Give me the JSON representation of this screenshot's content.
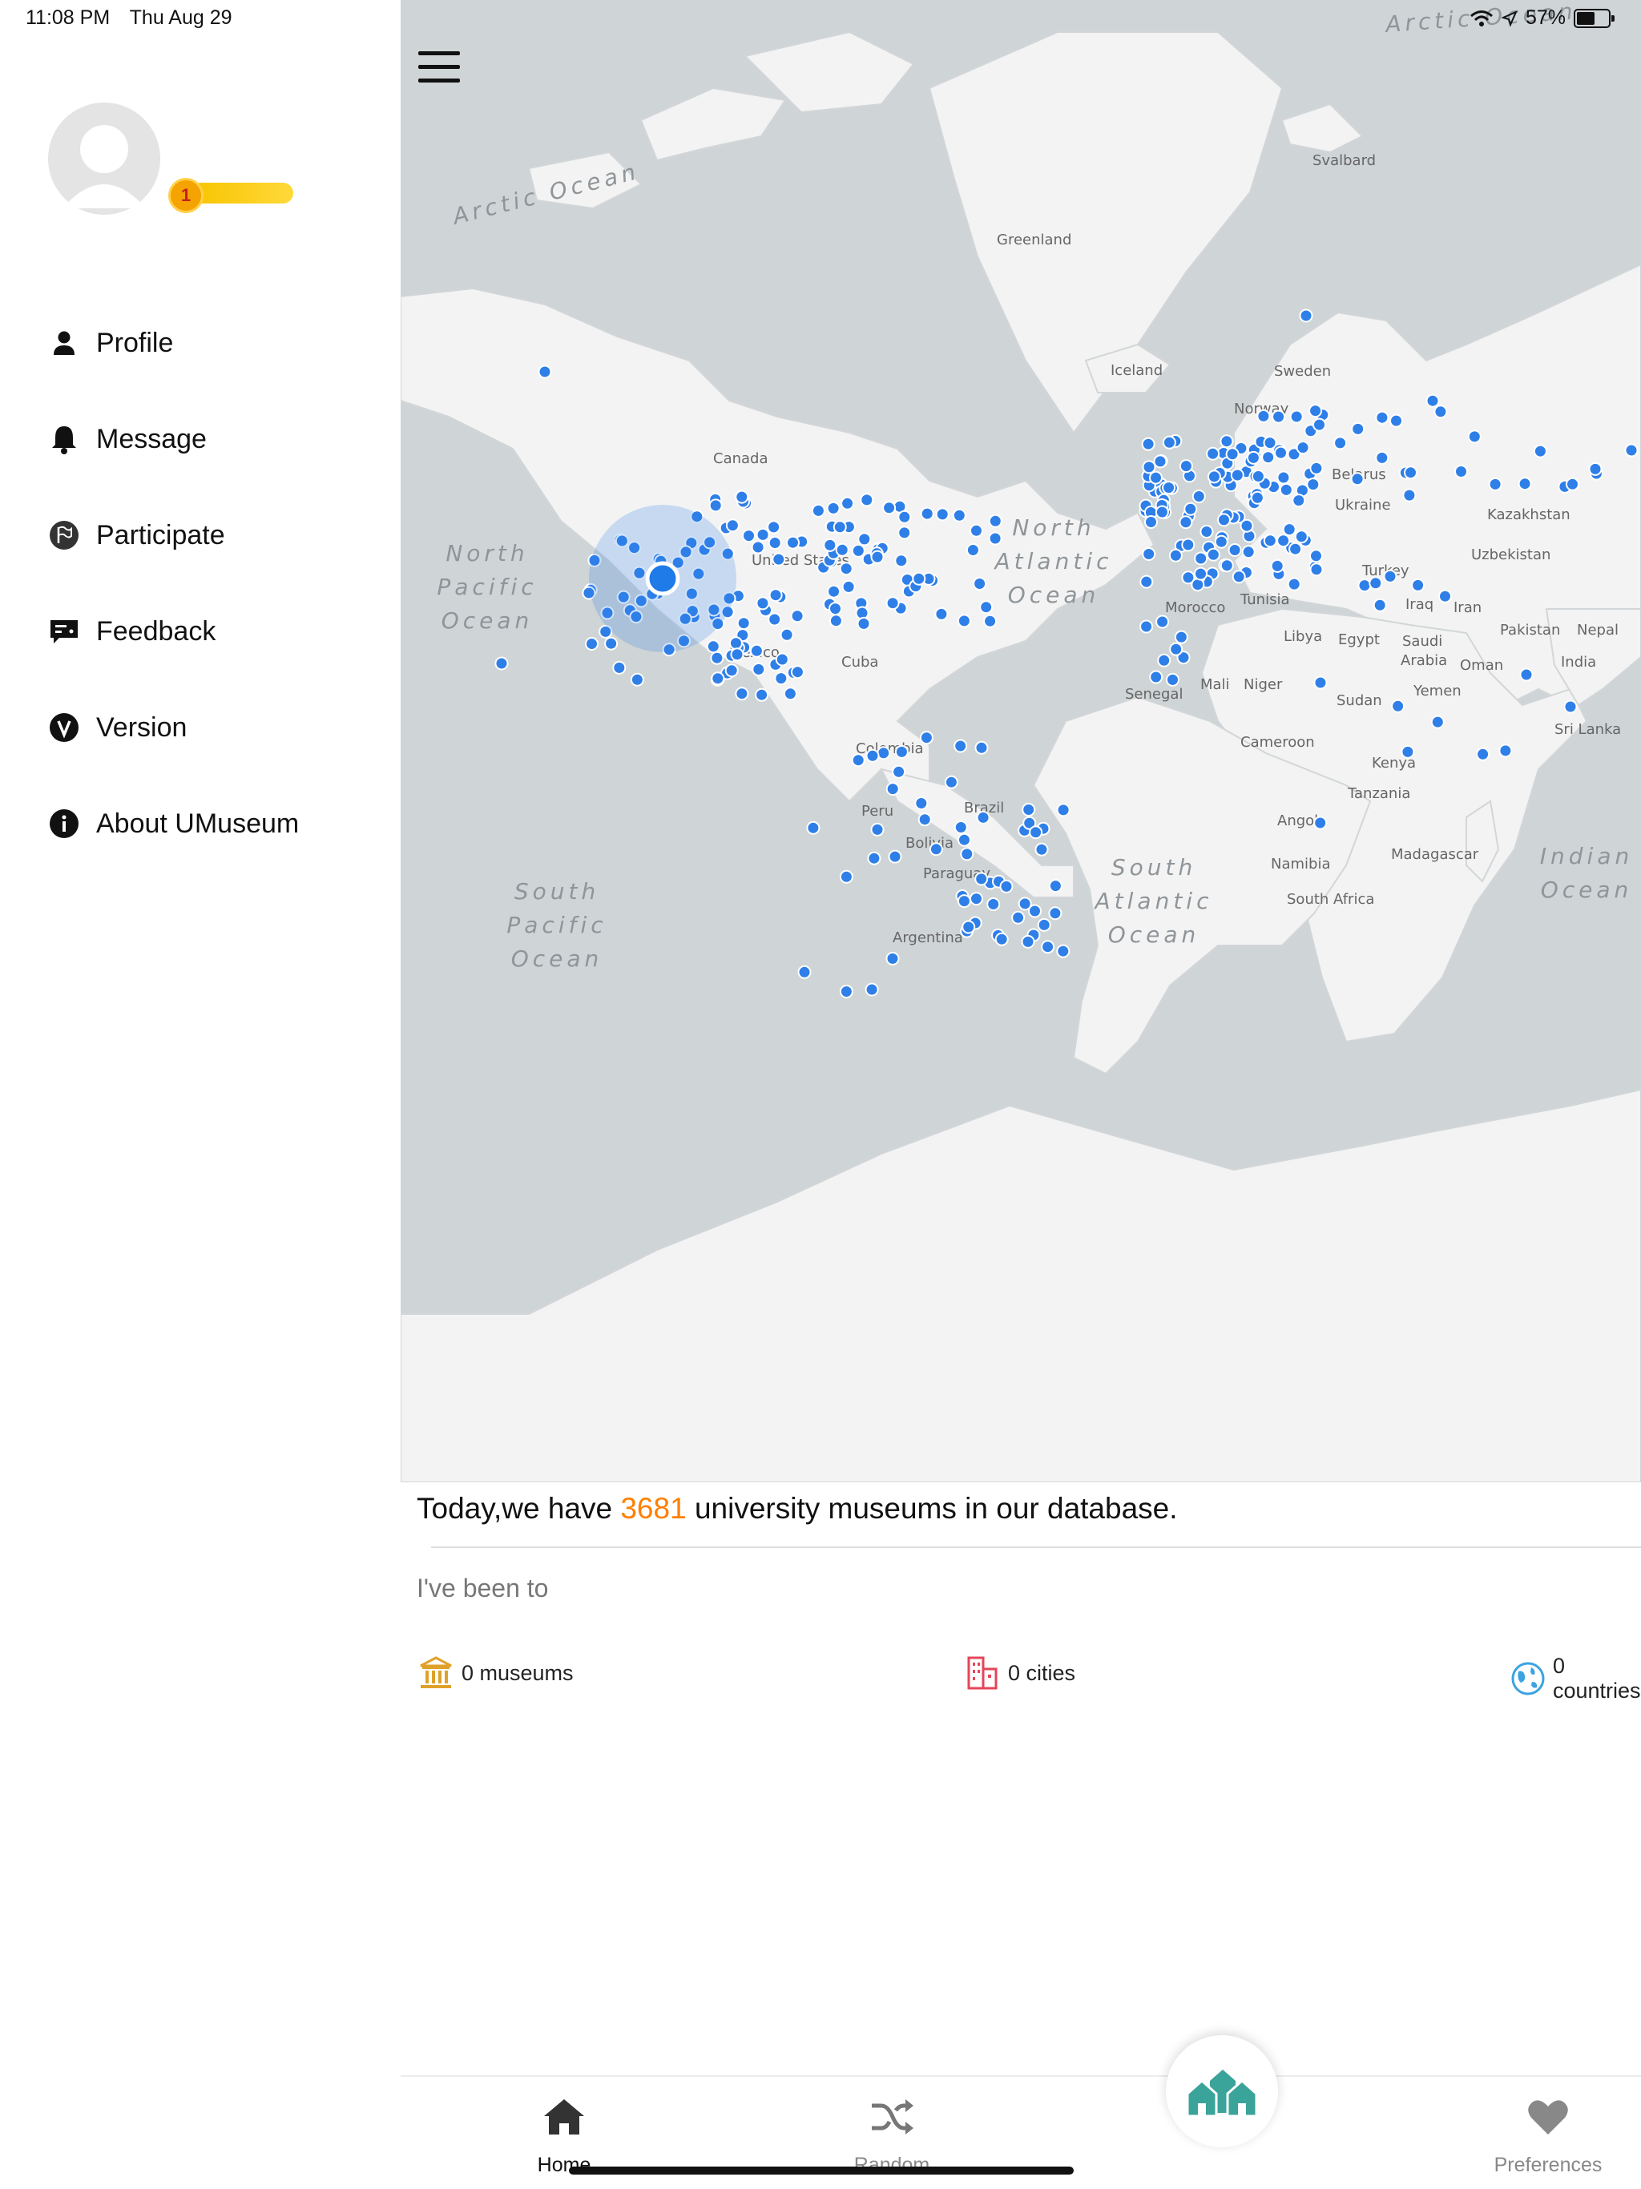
{
  "status_bar": {
    "time": "11:08 PM",
    "date": "Thu Aug 29",
    "battery": "57%",
    "battery_level": 0.57
  },
  "drawer": {
    "level": "1",
    "menu": [
      {
        "label": "Profile",
        "icon": "person-icon"
      },
      {
        "label": "Message",
        "icon": "bell-icon"
      },
      {
        "label": "Participate",
        "icon": "flag-icon"
      },
      {
        "label": "Feedback",
        "icon": "feedback-icon"
      },
      {
        "label": "Version",
        "icon": "version-icon"
      },
      {
        "label": "About UMuseum",
        "icon": "info-icon"
      }
    ]
  },
  "map": {
    "oceans": {
      "arctic_ocean": "Arctic Ocean",
      "north_pacific": [
        "North",
        "Pacific",
        "Ocean"
      ],
      "north_atlantic": [
        "North",
        "Atlantic",
        "Ocean"
      ],
      "south_pacific": [
        "South",
        "Pacific",
        "Ocean"
      ],
      "south_atlantic": [
        "South",
        "Atlantic",
        "Ocean"
      ],
      "indian": [
        "Indian",
        "Ocean"
      ]
    },
    "places": {
      "svalbard": "Svalbard",
      "greenland": "Greenland",
      "iceland": "Iceland",
      "sweden": "Sweden",
      "norway": "Norway",
      "canada": "Canada",
      "united_states": "United States",
      "mexico": "Mexico",
      "cuba": "Cuba",
      "colombia": "Colombia",
      "brazil": "Brazil",
      "peru": "Peru",
      "bolivia": "Bolivia",
      "paraguay": "Paraguay",
      "argentina": "Argentina",
      "belarus": "Belarus",
      "ukraine": "Ukraine",
      "kazakhstan": "Kazakhstan",
      "uzbekistan": "Uzbekistan",
      "turkey": "Turkey",
      "iraq": "Iraq",
      "iran": "Iran",
      "pakistan": "Pakistan",
      "nepal": "Nepal",
      "india": "India",
      "saudi_arabia": [
        "Saudi",
        "Arabia"
      ],
      "oman": "Oman",
      "yemen": "Yemen",
      "egypt": "Egypt",
      "libya": "Libya",
      "tunisia": "Tunisia",
      "morocco": "Morocco",
      "senegal": "Senegal",
      "mali": "Mali",
      "niger": "Niger",
      "sudan": "Sudan",
      "cameroon": "Cameroon",
      "kenya": "Kenya",
      "tanzania": "Tanzania",
      "angola": "Angola",
      "namibia": "Namibia",
      "south_africa": "South Africa",
      "madagascar": "Madagascar",
      "sri_lanka": "Sri Lanka"
    },
    "marker_color": "#2f7fe8"
  },
  "stats": {
    "prefix": "Today,we have ",
    "count": "3681",
    "suffix": " university museums in our database.",
    "been_to": "I've been to",
    "museums": "0 museums",
    "cities": "0 cities",
    "countries": "0 countries"
  },
  "tabs": {
    "home": "Home",
    "random": "Random",
    "preferences": "Preferences"
  }
}
